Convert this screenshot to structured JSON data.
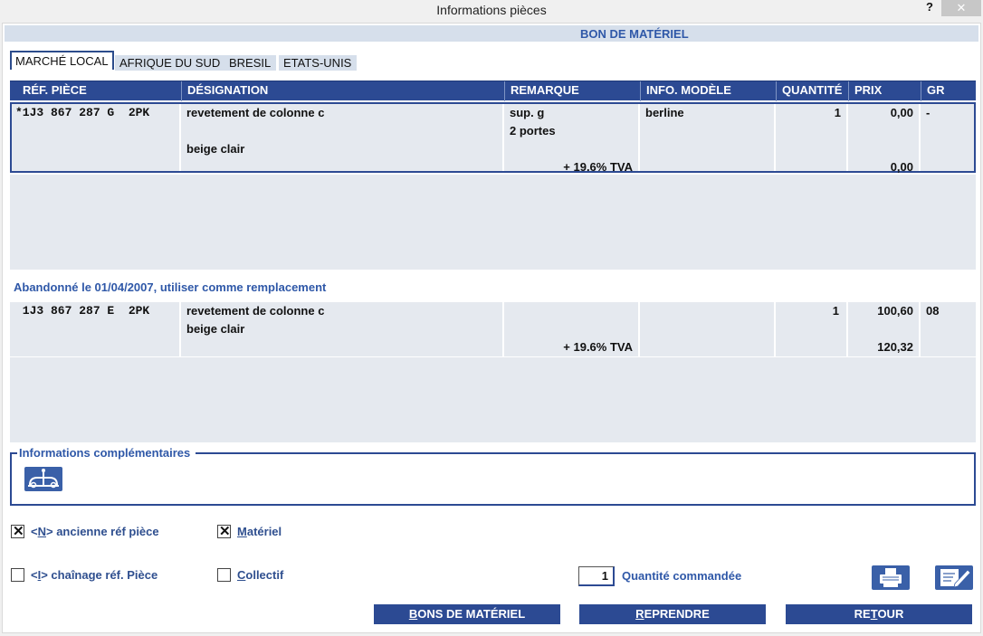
{
  "window": {
    "title": "Informations pièces",
    "help": "?",
    "close": "✕"
  },
  "banner": "BON DE MATÉRIEL",
  "tabs": [
    "MARCHÉ LOCAL",
    "AFRIQUE DU SUD",
    "BRESIL",
    "ETATS-UNIS"
  ],
  "columns": [
    "RÉF. PIÈCE",
    "DÉSIGNATION",
    "REMARQUE",
    "INFO. MODÈLE",
    "QUANTITÉ",
    "PRIX",
    "GR"
  ],
  "part": {
    "ref": "*1J3 867 287 G  2PK",
    "designation_1": "revetement de colonne c",
    "designation_2": "beige clair",
    "remark_1": "sup. g",
    "remark_2": "2 portes",
    "tax": "+ 19.6% TVA",
    "model": "berline",
    "quantity": "1",
    "price": "0,00",
    "price_tax": "0,00",
    "group": "-"
  },
  "abandon_note": "Abandonné le 01/04/2007, utiliser comme remplacement",
  "replacement": {
    "ref": " 1J3 867 287 E  2PK",
    "designation_1": "revetement de colonne c",
    "designation_2": "beige clair",
    "tax": "+ 19.6% TVA",
    "quantity": "1",
    "price": "100,60",
    "price_tax": "120,32",
    "group": "08"
  },
  "info": {
    "title": "Informations complémentaires"
  },
  "checkboxes": {
    "old_ref": {
      "prefix": "<",
      "key": "N",
      "suffix": "> ancienne réf pièce",
      "checked": true
    },
    "chain": {
      "prefix": "<",
      "key": "I",
      "suffix": "> chaînage réf. Pièce",
      "checked": false
    },
    "material": {
      "key": "M",
      "suffix": "atériel",
      "checked": true
    },
    "collective": {
      "key": "C",
      "suffix": "ollectif",
      "checked": false
    }
  },
  "order": {
    "quantity": "1",
    "label": "Quantité commandée"
  },
  "buttons": {
    "bons": {
      "key": "B",
      "rest": "ONS DE MATÉRIEL"
    },
    "reprendre": {
      "key": "R",
      "rest": "EPRENDRE"
    },
    "retour": {
      "pre": "RE",
      "key": "T",
      "rest": "OUR"
    }
  },
  "check_mark": "✕",
  "colors": {
    "header": "#2c4a93",
    "accent": "#2f58a8",
    "row": "#e5e9ef"
  }
}
